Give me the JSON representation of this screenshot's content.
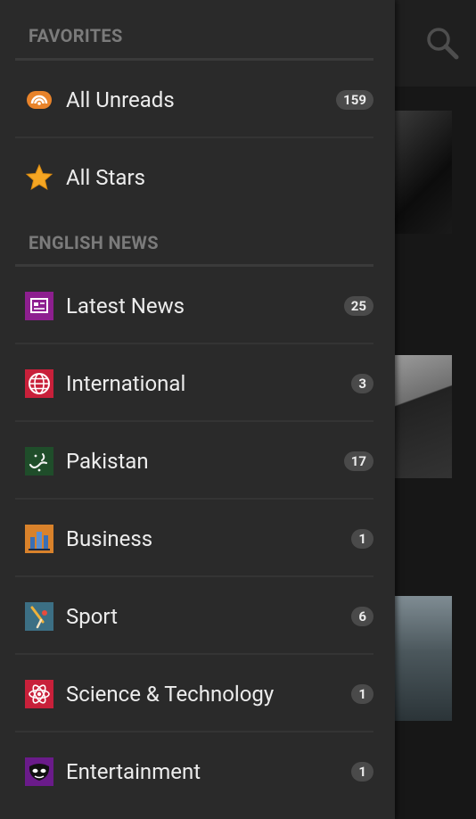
{
  "drawer": {
    "sections": [
      {
        "header": "FAVORITES",
        "items": [
          {
            "label": "All Unreads",
            "count": "159",
            "icon": "rss-icon"
          },
          {
            "label": "All Stars",
            "count": "",
            "icon": "star-icon"
          }
        ]
      },
      {
        "header": "ENGLISH NEWS",
        "items": [
          {
            "label": "Latest News",
            "count": "25",
            "icon": "newspaper-icon"
          },
          {
            "label": "International",
            "count": "3",
            "icon": "globe-icon"
          },
          {
            "label": "Pakistan",
            "count": "17",
            "icon": "urdu-logo-icon"
          },
          {
            "label": "Business",
            "count": "1",
            "icon": "business-icon"
          },
          {
            "label": "Sport",
            "count": "6",
            "icon": "sport-icon"
          },
          {
            "label": "Science & Technology",
            "count": "1",
            "icon": "atom-icon"
          },
          {
            "label": "Entertainment",
            "count": "1",
            "icon": "entertainment-icon"
          }
        ]
      }
    ]
  },
  "background": {
    "search_icon": "search-icon"
  }
}
